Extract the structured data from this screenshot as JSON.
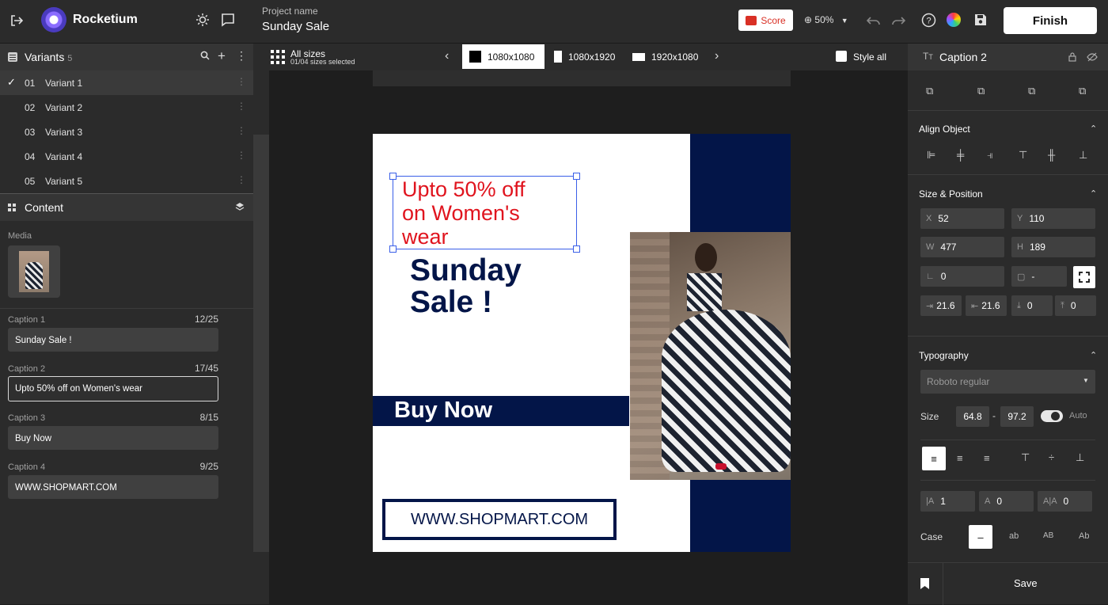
{
  "app": {
    "name": "Rocketium",
    "project_label": "Project name",
    "project_name": "Sunday Sale"
  },
  "toolbar": {
    "score_label": "Score",
    "zoom": "50%",
    "finish_label": "Finish"
  },
  "variants": {
    "title": "Variants",
    "count": "5",
    "items": [
      {
        "num": "01",
        "name": "Variant 1",
        "selected": true
      },
      {
        "num": "02",
        "name": "Variant 2"
      },
      {
        "num": "03",
        "name": "Variant 3"
      },
      {
        "num": "04",
        "name": "Variant 4"
      },
      {
        "num": "05",
        "name": "Variant 5"
      }
    ]
  },
  "content": {
    "title": "Content",
    "media_label": "Media",
    "captions": [
      {
        "label": "Caption 1",
        "count": "12/25",
        "value": "Sunday Sale !"
      },
      {
        "label": "Caption 2",
        "count": "17/45",
        "value": "Upto 50% off on Women's wear"
      },
      {
        "label": "Caption 3",
        "count": "8/15",
        "value": "Buy Now"
      },
      {
        "label": "Caption 4",
        "count": "9/25",
        "value": "WWW.SHOPMART.COM"
      }
    ]
  },
  "sizes": {
    "all_label": "All sizes",
    "selected_text": "01/04 sizes selected",
    "tabs": [
      "1080x1080",
      "1080x1920",
      "1920x1080"
    ],
    "style_all": "Style all"
  },
  "design": {
    "offer_line1": "Upto 50% off",
    "offer_line2": "on Women's",
    "offer_line3": "wear",
    "title_line1": "Sunday",
    "title_line2": "Sale !",
    "cta": "Buy Now",
    "url": "WWW.SHOPMART.COM",
    "colors": {
      "navy": "#031548",
      "red": "#e0141e"
    }
  },
  "inspector": {
    "element": "Caption 2",
    "align_title": "Align Object",
    "size_title": "Size & Position",
    "x_label": "X",
    "x": "52",
    "y_label": "Y",
    "y": "110",
    "w_label": "W",
    "w": "477",
    "h_label": "H",
    "h": "189",
    "rotation": "0",
    "radius": "-",
    "pad_left": "21.6",
    "pad_right": "21.6",
    "pad_bottom": "0",
    "pad_top": "0",
    "typography_title": "Typography",
    "font": "Roboto regular",
    "size_label": "Size",
    "size_min": "64.8",
    "size_sep": "-",
    "size_max": "97.2",
    "auto_label": "Auto",
    "line_height": "1",
    "letter_spacing": "0",
    "word_spacing": "0",
    "case_label": "Case",
    "case_options": [
      "–",
      "ab",
      "AB",
      "Ab"
    ],
    "save_label": "Save"
  }
}
